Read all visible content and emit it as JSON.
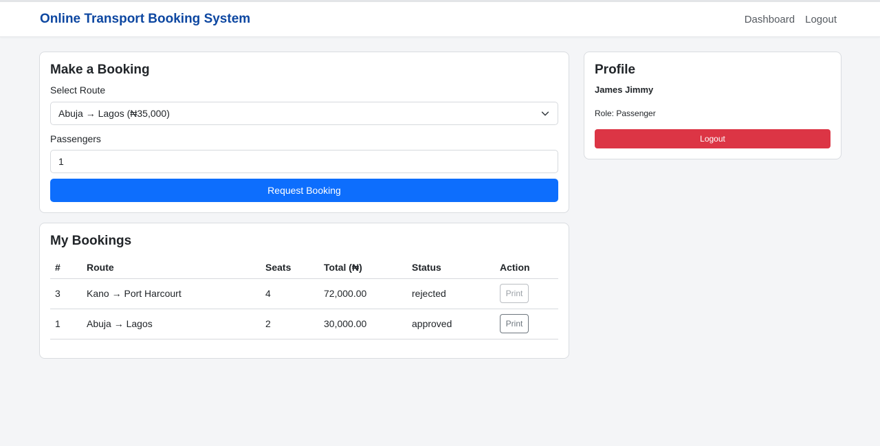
{
  "header": {
    "brand": "Online Transport Booking System",
    "nav": [
      {
        "label": "Dashboard"
      },
      {
        "label": "Logout"
      }
    ]
  },
  "booking_form": {
    "title": "Make a Booking",
    "route_label": "Select Route",
    "route_selected": "Abuja → Lagos (₦35,000)",
    "passengers_label": "Passengers",
    "passengers_value": "1",
    "submit_label": "Request Booking"
  },
  "bookings": {
    "title": "My Bookings",
    "columns": [
      "#",
      "Route",
      "Seats",
      "Total (₦)",
      "Status",
      "Action"
    ],
    "rows": [
      {
        "id": "3",
        "route": "Kano → Port Harcourt",
        "seats": "4",
        "total": "72,000.00",
        "status": "rejected",
        "action": "Print"
      },
      {
        "id": "1",
        "route": "Abuja → Lagos",
        "seats": "2",
        "total": "30,000.00",
        "status": "approved",
        "action": "Print"
      }
    ]
  },
  "profile": {
    "title": "Profile",
    "name": "James Jimmy",
    "role": "Role: Passenger",
    "logout_label": "Logout"
  },
  "colors": {
    "brand": "#0d47a1",
    "primary": "#0d6efd",
    "danger": "#dc3545",
    "background": "#f4f5f7"
  }
}
